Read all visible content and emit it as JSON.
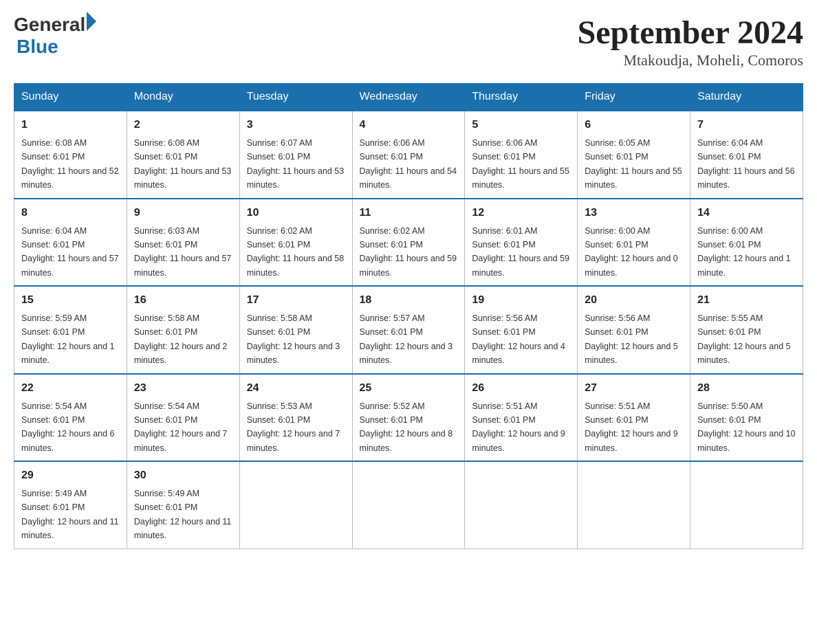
{
  "logo": {
    "general": "General",
    "blue": "Blue"
  },
  "title": "September 2024",
  "subtitle": "Mtakoudja, Moheli, Comoros",
  "days_of_week": [
    "Sunday",
    "Monday",
    "Tuesday",
    "Wednesday",
    "Thursday",
    "Friday",
    "Saturday"
  ],
  "weeks": [
    [
      {
        "day": "1",
        "sunrise": "6:08 AM",
        "sunset": "6:01 PM",
        "daylight": "11 hours and 52 minutes."
      },
      {
        "day": "2",
        "sunrise": "6:08 AM",
        "sunset": "6:01 PM",
        "daylight": "11 hours and 53 minutes."
      },
      {
        "day": "3",
        "sunrise": "6:07 AM",
        "sunset": "6:01 PM",
        "daylight": "11 hours and 53 minutes."
      },
      {
        "day": "4",
        "sunrise": "6:06 AM",
        "sunset": "6:01 PM",
        "daylight": "11 hours and 54 minutes."
      },
      {
        "day": "5",
        "sunrise": "6:06 AM",
        "sunset": "6:01 PM",
        "daylight": "11 hours and 55 minutes."
      },
      {
        "day": "6",
        "sunrise": "6:05 AM",
        "sunset": "6:01 PM",
        "daylight": "11 hours and 55 minutes."
      },
      {
        "day": "7",
        "sunrise": "6:04 AM",
        "sunset": "6:01 PM",
        "daylight": "11 hours and 56 minutes."
      }
    ],
    [
      {
        "day": "8",
        "sunrise": "6:04 AM",
        "sunset": "6:01 PM",
        "daylight": "11 hours and 57 minutes."
      },
      {
        "day": "9",
        "sunrise": "6:03 AM",
        "sunset": "6:01 PM",
        "daylight": "11 hours and 57 minutes."
      },
      {
        "day": "10",
        "sunrise": "6:02 AM",
        "sunset": "6:01 PM",
        "daylight": "11 hours and 58 minutes."
      },
      {
        "day": "11",
        "sunrise": "6:02 AM",
        "sunset": "6:01 PM",
        "daylight": "11 hours and 59 minutes."
      },
      {
        "day": "12",
        "sunrise": "6:01 AM",
        "sunset": "6:01 PM",
        "daylight": "11 hours and 59 minutes."
      },
      {
        "day": "13",
        "sunrise": "6:00 AM",
        "sunset": "6:01 PM",
        "daylight": "12 hours and 0 minutes."
      },
      {
        "day": "14",
        "sunrise": "6:00 AM",
        "sunset": "6:01 PM",
        "daylight": "12 hours and 1 minute."
      }
    ],
    [
      {
        "day": "15",
        "sunrise": "5:59 AM",
        "sunset": "6:01 PM",
        "daylight": "12 hours and 1 minute."
      },
      {
        "day": "16",
        "sunrise": "5:58 AM",
        "sunset": "6:01 PM",
        "daylight": "12 hours and 2 minutes."
      },
      {
        "day": "17",
        "sunrise": "5:58 AM",
        "sunset": "6:01 PM",
        "daylight": "12 hours and 3 minutes."
      },
      {
        "day": "18",
        "sunrise": "5:57 AM",
        "sunset": "6:01 PM",
        "daylight": "12 hours and 3 minutes."
      },
      {
        "day": "19",
        "sunrise": "5:56 AM",
        "sunset": "6:01 PM",
        "daylight": "12 hours and 4 minutes."
      },
      {
        "day": "20",
        "sunrise": "5:56 AM",
        "sunset": "6:01 PM",
        "daylight": "12 hours and 5 minutes."
      },
      {
        "day": "21",
        "sunrise": "5:55 AM",
        "sunset": "6:01 PM",
        "daylight": "12 hours and 5 minutes."
      }
    ],
    [
      {
        "day": "22",
        "sunrise": "5:54 AM",
        "sunset": "6:01 PM",
        "daylight": "12 hours and 6 minutes."
      },
      {
        "day": "23",
        "sunrise": "5:54 AM",
        "sunset": "6:01 PM",
        "daylight": "12 hours and 7 minutes."
      },
      {
        "day": "24",
        "sunrise": "5:53 AM",
        "sunset": "6:01 PM",
        "daylight": "12 hours and 7 minutes."
      },
      {
        "day": "25",
        "sunrise": "5:52 AM",
        "sunset": "6:01 PM",
        "daylight": "12 hours and 8 minutes."
      },
      {
        "day": "26",
        "sunrise": "5:51 AM",
        "sunset": "6:01 PM",
        "daylight": "12 hours and 9 minutes."
      },
      {
        "day": "27",
        "sunrise": "5:51 AM",
        "sunset": "6:01 PM",
        "daylight": "12 hours and 9 minutes."
      },
      {
        "day": "28",
        "sunrise": "5:50 AM",
        "sunset": "6:01 PM",
        "daylight": "12 hours and 10 minutes."
      }
    ],
    [
      {
        "day": "29",
        "sunrise": "5:49 AM",
        "sunset": "6:01 PM",
        "daylight": "12 hours and 11 minutes."
      },
      {
        "day": "30",
        "sunrise": "5:49 AM",
        "sunset": "6:01 PM",
        "daylight": "12 hours and 11 minutes."
      },
      null,
      null,
      null,
      null,
      null
    ]
  ],
  "labels": {
    "sunrise": "Sunrise:",
    "sunset": "Sunset:",
    "daylight": "Daylight:"
  }
}
